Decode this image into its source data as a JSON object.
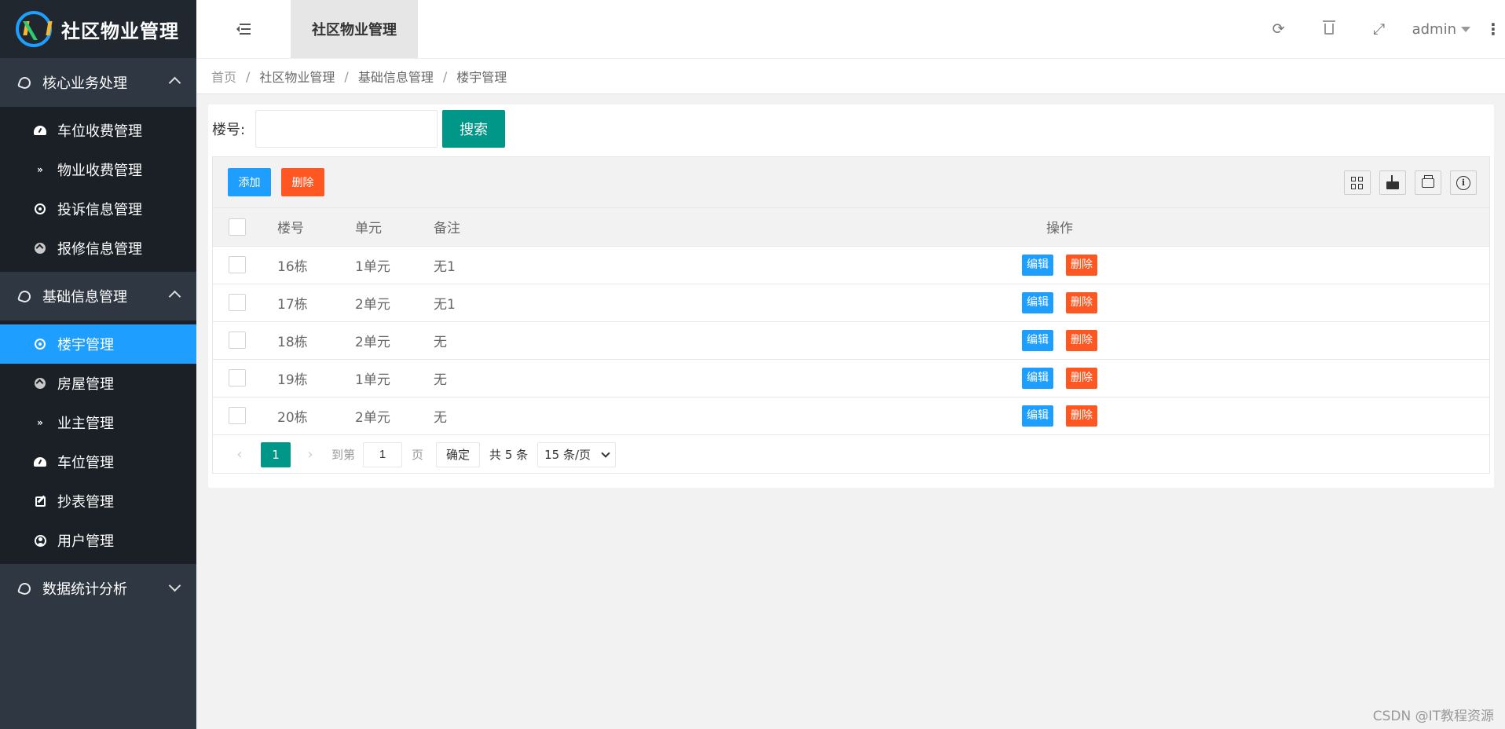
{
  "app": {
    "title": "社区物业管理"
  },
  "sidebar": {
    "groups": [
      {
        "label": "核心业务处理",
        "expanded": true,
        "items": [
          {
            "label": "车位收费管理",
            "icon": "gauge-icon"
          },
          {
            "label": "物业收费管理",
            "icon": "double-chevron-icon"
          },
          {
            "label": "投诉信息管理",
            "icon": "target-icon"
          },
          {
            "label": "报修信息管理",
            "icon": "up-circle-icon"
          }
        ]
      },
      {
        "label": "基础信息管理",
        "expanded": true,
        "items": [
          {
            "label": "楼宇管理",
            "icon": "target-icon",
            "active": true
          },
          {
            "label": "房屋管理",
            "icon": "up-circle-icon"
          },
          {
            "label": "业主管理",
            "icon": "double-chevron-icon"
          },
          {
            "label": "车位管理",
            "icon": "gauge-icon"
          },
          {
            "label": "抄表管理",
            "icon": "edit-icon"
          },
          {
            "label": "用户管理",
            "icon": "user-icon"
          }
        ]
      },
      {
        "label": "数据统计分析",
        "expanded": false,
        "items": []
      }
    ]
  },
  "header": {
    "tab": "社区物业管理",
    "user": "admin",
    "icons": [
      "refresh-icon",
      "trash-icon",
      "fullscreen-icon",
      "more-icon"
    ]
  },
  "breadcrumb": [
    "首页",
    "社区物业管理",
    "基础信息管理",
    "楼宇管理"
  ],
  "search": {
    "label": "楼号:",
    "value": "",
    "button": "搜索"
  },
  "toolbar": {
    "add": "添加",
    "delete": "删除"
  },
  "table": {
    "columns": [
      "楼号",
      "单元",
      "备注",
      "操作"
    ],
    "rows": [
      {
        "building": "16栋",
        "unit": "1单元",
        "note": "无1"
      },
      {
        "building": "17栋",
        "unit": "2单元",
        "note": "无1"
      },
      {
        "building": "18栋",
        "unit": "2单元",
        "note": "无"
      },
      {
        "building": "19栋",
        "unit": "1单元",
        "note": "无"
      },
      {
        "building": "20栋",
        "unit": "2单元",
        "note": "无"
      }
    ],
    "row_actions": {
      "edit": "编辑",
      "delete": "删除"
    }
  },
  "pager": {
    "prev": "‹",
    "next": "›",
    "current": "1",
    "goto_label": "到第",
    "goto_value": "1",
    "page_suffix": "页",
    "confirm": "确定",
    "total": "共 5 条",
    "page_size": "15 条/页"
  },
  "watermark": "CSDN @IT教程资源",
  "colors": {
    "primary": "#009688",
    "blue": "#1e9fff",
    "danger": "#ff5722",
    "sidebar": "#2e3742"
  }
}
